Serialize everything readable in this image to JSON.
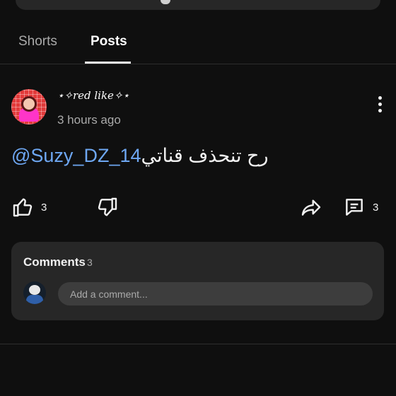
{
  "tabs": [
    {
      "label": "Shorts",
      "active": false
    },
    {
      "label": "Posts",
      "active": true
    }
  ],
  "post": {
    "channel_name": "⋆✧red like✧⋆",
    "timestamp": "3 hours ago",
    "mention": "@Suzy_DZ_14",
    "text": "رح تنحذف قناتي",
    "likes": "3",
    "comments": "3"
  },
  "comments_panel": {
    "title": "Comments",
    "count": "3",
    "input_placeholder": "Add a comment..."
  },
  "icons": {
    "like": "thumb-up-icon",
    "dislike": "thumb-down-icon",
    "share": "share-icon",
    "comment": "comment-icon",
    "more": "more-vert-icon"
  },
  "colors": {
    "background": "#0f0f0f",
    "card": "#272727",
    "mention": "#6ea7f2",
    "secondary_text": "#aaaaaa"
  }
}
